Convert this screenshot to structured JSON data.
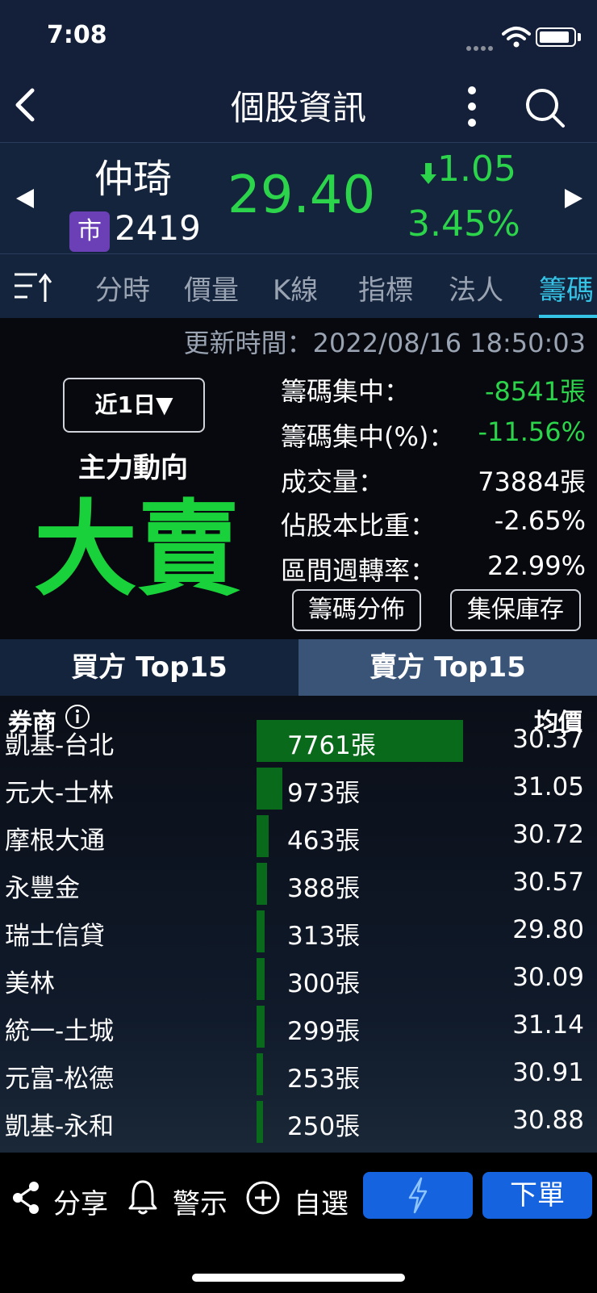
{
  "status_bar": {
    "time": "7:08"
  },
  "nav": {
    "title": "個股資訊"
  },
  "quote": {
    "name": "仲琦",
    "market_badge": "市",
    "code": "2419",
    "price": "29.40",
    "change": "1.05",
    "change_pct": "3.45%"
  },
  "tabs": [
    {
      "label": "分時"
    },
    {
      "label": "價量"
    },
    {
      "label": "K線"
    },
    {
      "label": "指標"
    },
    {
      "label": "法人"
    },
    {
      "label": "籌碼"
    }
  ],
  "info": {
    "update_time": "更新時間：2022/08/16 18:50:03",
    "period": "近1日▼",
    "main_force_label": "主力動向",
    "main_force_value": "大賣",
    "stats": [
      {
        "label": "籌碼集中：",
        "value": "-8541張"
      },
      {
        "label": "籌碼集中(%)：",
        "value": "-11.56%"
      },
      {
        "label": "成交量：",
        "value": "73884張"
      },
      {
        "label": "佔股本比重：",
        "value": "-2.65%"
      },
      {
        "label": "區間週轉率：",
        "value": "22.99%"
      }
    ],
    "buttons": {
      "distribution": "籌碼分佈",
      "custody": "集保庫存"
    }
  },
  "toggle": {
    "buy": "買方 Top15",
    "sell": "賣方 Top15"
  },
  "table": {
    "col_broker": "券商",
    "col_avg": "均價",
    "rows": [
      {
        "broker": "凱基-台北",
        "qty": "7761張",
        "qty_value": 7761,
        "avg": "30.37"
      },
      {
        "broker": "元大-士林",
        "qty": "973張",
        "qty_value": 973,
        "avg": "31.05"
      },
      {
        "broker": "摩根大通",
        "qty": "463張",
        "qty_value": 463,
        "avg": "30.72"
      },
      {
        "broker": "永豐金",
        "qty": "388張",
        "qty_value": 388,
        "avg": "30.57"
      },
      {
        "broker": "瑞士信貸",
        "qty": "313張",
        "qty_value": 313,
        "avg": "29.80"
      },
      {
        "broker": "美林",
        "qty": "300張",
        "qty_value": 300,
        "avg": "30.09"
      },
      {
        "broker": "統一-土城",
        "qty": "299張",
        "qty_value": 299,
        "avg": "31.14"
      },
      {
        "broker": "元富-松德",
        "qty": "253張",
        "qty_value": 253,
        "avg": "30.91"
      },
      {
        "broker": "凱基-永和",
        "qty": "250張",
        "qty_value": 250,
        "avg": "30.88"
      }
    ]
  },
  "bottom": {
    "share": "分享",
    "alert": "警示",
    "watch": "自選",
    "order": "下單"
  },
  "colors": {
    "up_green": "#2bd44a",
    "accent": "#35c3e6",
    "button_blue": "#1663e0"
  }
}
